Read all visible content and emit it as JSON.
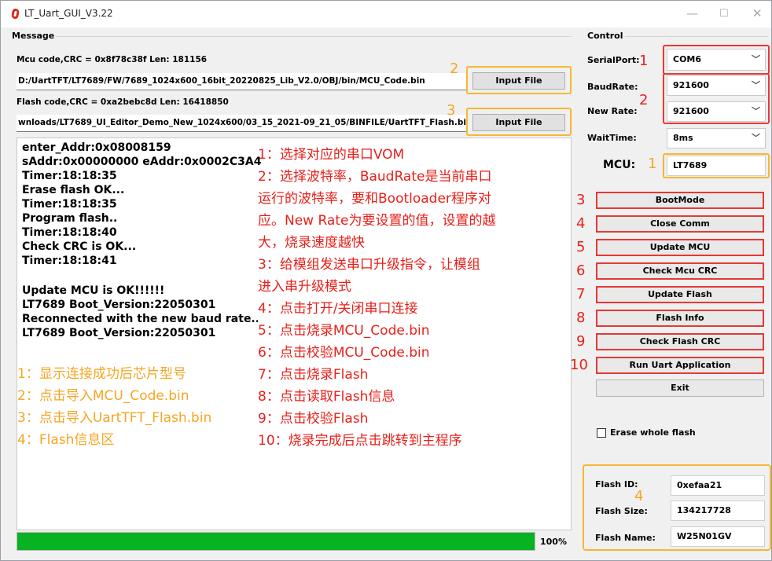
{
  "window": {
    "title": "LT_Uart_GUI_V3.22",
    "min": "—",
    "max": "☐",
    "close": "✕"
  },
  "message": {
    "group_label": "Message",
    "mcu_crc": "Mcu code,CRC = 0x8f78c38f  Len: 181156",
    "mcu_path": "D:/UartTFT/LT7689/FW/7689_1024x600_16bit_20220825_Lib_V2.0/OBJ/bin/MCU_Code.bin",
    "flash_crc": "Flash code,CRC = 0xa2bebc8d  Len: 16418850",
    "flash_path": "wnloads/LT7689_UI_Editor_Demo_New_1024x600/03_15_2021-09_21_05/BINFILE/UartTFT_Flash.bin",
    "input_file_1": "Input File",
    "input_file_2": "Input File",
    "log": [
      "enter_Addr:0x08008159",
      "sAddr:0x00000000 eAddr:0x0002C3A4",
      "Timer:18:18:35",
      "Erase flash OK...",
      "Timer:18:18:35",
      "Program flash..",
      "Timer:18:18:40",
      "Check CRC is OK...",
      "Timer:18:18:41",
      "Update MCU is OK!!!!!!",
      "LT7689 Boot_Version:22050301",
      "Reconnected with the new baud rate...",
      "LT7689 Boot_Version:22050301"
    ],
    "progress_value": 1.0,
    "progress_text": "100%"
  },
  "annotations_orange": [
    "1：显示连接成功后芯片型号",
    "2：点击导入MCU_Code.bin",
    "3：点击导入UartTFT_Flash.bin",
    "4：Flash信息区"
  ],
  "annotations_red": [
    "1：选择对应的串口VOM",
    "2：选择波特率，BaudRate是当前串口",
    "运行的波特率，要和Bootloader程序对",
    "应。New Rate为要设置的值，设置的越",
    "大，烧录速度越快",
    "3：给模组发送串口升级指令，让模组",
    "进入串升级模式",
    "4：点击打开/关闭串口连接",
    "5：点击烧录MCU_Code.bin",
    "6：点击校验MCU_Code.bin",
    "7：点击烧录Flash",
    "8：点击读取Flash信息",
    "9：点击校验Flash",
    "10：烧录完成后点击跳转到主程序"
  ],
  "markers": {
    "msg_2": "2",
    "msg_3": "3",
    "serial": "1",
    "baud": "2",
    "mcu": "1",
    "flash": "4",
    "b3": "3",
    "b4": "4",
    "b5": "5",
    "b6": "6",
    "b7": "7",
    "b8": "8",
    "b9": "9",
    "b10": "10"
  },
  "control": {
    "group_label": "Control",
    "serial_label": "SerialPort:",
    "serial_value": "COM6",
    "baud_label": "BaudRate:",
    "baud_value": "921600",
    "newrate_label": "New Rate:",
    "newrate_value": "921600",
    "wait_label": "WaitTime:",
    "wait_value": "8ms",
    "mcu_label": "MCU:",
    "mcu_value": "LT7689",
    "buttons": [
      "BootMode",
      "Close Comm",
      "Update MCU",
      "Check Mcu CRC",
      "Update Flash",
      "Flash Info",
      "Check Flash CRC",
      "Run Uart Application",
      "Exit"
    ],
    "erase_label": "Erase whole flash",
    "flash_id_label": "Flash ID:",
    "flash_id": "0xefaa21",
    "flash_size_label": "Flash Size:",
    "flash_size": "134217728",
    "flash_name_label": "Flash Name:",
    "flash_name": "W25N01GV"
  },
  "colors": {
    "annotation_orange": "#f5a623",
    "annotation_red": "#e8201a",
    "progress": "#07b223"
  }
}
